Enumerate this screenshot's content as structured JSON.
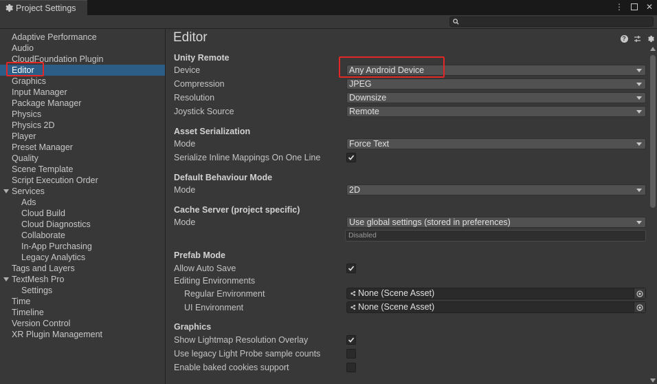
{
  "window": {
    "tab_title": "Project Settings"
  },
  "sidebar": {
    "items": [
      {
        "label": "Adaptive Performance"
      },
      {
        "label": "Audio"
      },
      {
        "label": "CloudFoundation Plugin"
      },
      {
        "label": "Editor",
        "selected": true
      },
      {
        "label": "Graphics"
      },
      {
        "label": "Input Manager"
      },
      {
        "label": "Package Manager"
      },
      {
        "label": "Physics"
      },
      {
        "label": "Physics 2D"
      },
      {
        "label": "Player"
      },
      {
        "label": "Preset Manager"
      },
      {
        "label": "Quality"
      },
      {
        "label": "Scene Template"
      },
      {
        "label": "Script Execution Order"
      },
      {
        "label": "Services",
        "expanded": true
      },
      {
        "label": "Ads",
        "child": true
      },
      {
        "label": "Cloud Build",
        "child": true
      },
      {
        "label": "Cloud Diagnostics",
        "child": true
      },
      {
        "label": "Collaborate",
        "child": true
      },
      {
        "label": "In-App Purchasing",
        "child": true
      },
      {
        "label": "Legacy Analytics",
        "child": true
      },
      {
        "label": "Tags and Layers"
      },
      {
        "label": "TextMesh Pro",
        "expanded": true
      },
      {
        "label": "Settings",
        "child": true
      },
      {
        "label": "Time"
      },
      {
        "label": "Timeline"
      },
      {
        "label": "Version Control"
      },
      {
        "label": "XR Plugin Management"
      }
    ]
  },
  "main": {
    "title": "Editor",
    "unity_remote": {
      "header": "Unity Remote",
      "device_label": "Device",
      "device_value": "Any Android Device",
      "compression_label": "Compression",
      "compression_value": "JPEG",
      "resolution_label": "Resolution",
      "resolution_value": "Downsize",
      "joystick_label": "Joystick Source",
      "joystick_value": "Remote"
    },
    "asset_serialization": {
      "header": "Asset Serialization",
      "mode_label": "Mode",
      "mode_value": "Force Text",
      "inline_label": "Serialize Inline Mappings On One Line",
      "inline_checked": true
    },
    "default_behaviour": {
      "header": "Default Behaviour Mode",
      "mode_label": "Mode",
      "mode_value": "2D"
    },
    "cache_server": {
      "header": "Cache Server (project specific)",
      "mode_label": "Mode",
      "mode_value": "Use global settings (stored in preferences)",
      "status": "Disabled"
    },
    "prefab_mode": {
      "header": "Prefab Mode",
      "auto_save_label": "Allow Auto Save",
      "auto_save_checked": true,
      "editing_env_label": "Editing Environments",
      "regular_env_label": "Regular Environment",
      "regular_env_value": "None (Scene Asset)",
      "ui_env_label": "UI Environment",
      "ui_env_value": "None (Scene Asset)"
    },
    "graphics": {
      "header": "Graphics",
      "lightmap_label": "Show Lightmap Resolution Overlay",
      "lightmap_checked": true,
      "legacy_probe_label": "Use legacy Light Probe sample counts",
      "legacy_probe_checked": false,
      "baked_cookies_label": "Enable baked cookies support",
      "baked_cookies_checked": false
    }
  },
  "colors": {
    "selection": "#2c5d87",
    "highlight_box": "#e32626",
    "background": "#383838"
  }
}
